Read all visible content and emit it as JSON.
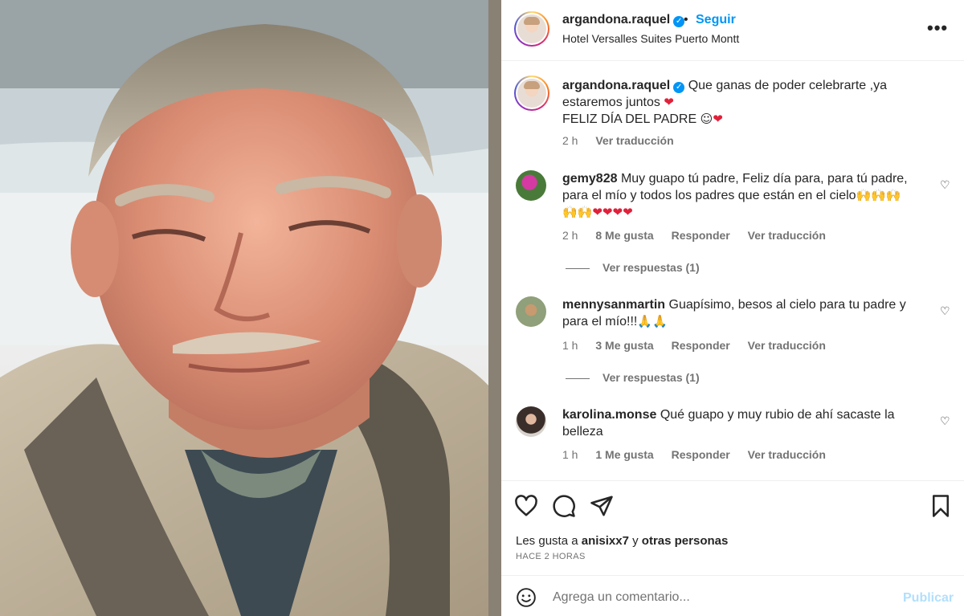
{
  "post": {
    "username": "argandona.raquel",
    "separator": "•",
    "follow_label": "Seguir",
    "location": "Hotel Versalles Suites Puerto Montt",
    "more_icon": "more-options-icon"
  },
  "caption": {
    "username": "argandona.raquel",
    "line1": "Que ganas de poder celebrarte ,ya estaremos juntos",
    "line2": "FELIZ DÍA DEL PADRE",
    "time": "2 h",
    "translate": "Ver traducción"
  },
  "comments": [
    {
      "username": "gemy828",
      "text": "Muy guapo tú padre, Feliz día para, para tú padre, para el mío y todos los padres que están en el cielo",
      "time": "2 h",
      "likes": "8 Me gusta",
      "reply": "Responder",
      "translate": "Ver traducción",
      "replies": "Ver respuestas (1)"
    },
    {
      "username": "mennysanmartin",
      "text": "Guapísimo, besos al cielo para tu padre y para el mío!!!",
      "time": "1 h",
      "likes": "3 Me gusta",
      "reply": "Responder",
      "translate": "Ver traducción",
      "replies": "Ver respuestas (1)"
    },
    {
      "username": "karolina.monse",
      "text": "Qué guapo y muy rubio de ahí sacaste la belleza",
      "time": "1 h",
      "likes": "1 Me gusta",
      "reply": "Responder",
      "translate": "Ver traducción"
    }
  ],
  "likes": {
    "prefix": "Les gusta a",
    "user": "anisixx7",
    "conj": "y",
    "others": "otras personas"
  },
  "time_ago": "HACE 2 HORAS",
  "add_comment": {
    "placeholder": "Agrega un comentario...",
    "publish_label": "Publicar"
  },
  "colors": {
    "accent": "#0095f6",
    "publish_disabled": "#b2dffc",
    "text": "#262626",
    "muted": "#737373"
  }
}
